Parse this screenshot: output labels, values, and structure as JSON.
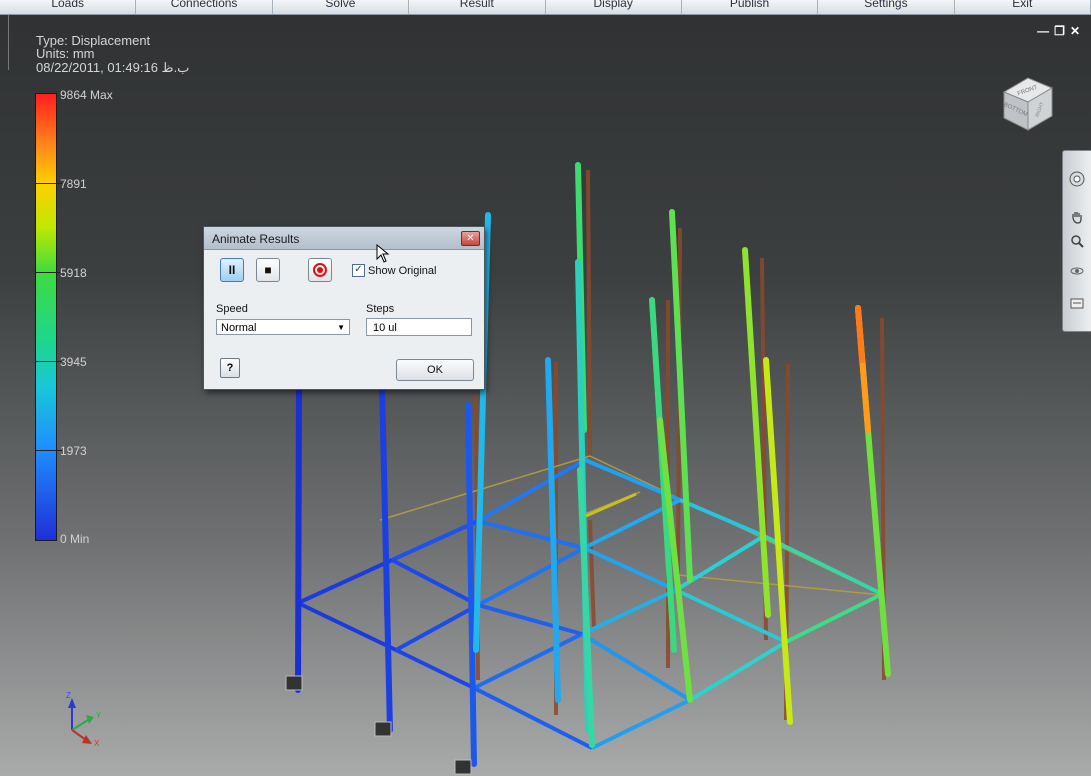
{
  "ribbon": {
    "tabs": [
      "Loads",
      "Connections",
      "Solve",
      "Result",
      "Display",
      "Publish",
      "Settings",
      "Exit"
    ]
  },
  "result_info": {
    "type": "Type: Displacement",
    "units": "Units: mm",
    "datetime": "08/22/2011, 01:49:16 ب.ظ"
  },
  "legend": {
    "max_label": "9864 Max",
    "values": [
      "7891",
      "5918",
      "3945",
      "1973"
    ],
    "min_label": "0 Min"
  },
  "window_controls": {
    "minimize": "—",
    "restore": "❐",
    "close": "✕"
  },
  "viewcube": {
    "faces": [
      "FRONT",
      "BOTTOM",
      "RIGHT"
    ]
  },
  "triad": {
    "z": "Z",
    "y": "Y",
    "x": "X"
  },
  "dialog": {
    "title": "Animate Results",
    "show_original_label": "Show Original",
    "show_original_checked": true,
    "speed_label": "Speed",
    "speed_value": "Normal",
    "steps_label": "Steps",
    "steps_value": "10 ul",
    "ok_label": "OK",
    "help_glyph": "?",
    "pause_glyph": "II",
    "stop_glyph": "■"
  },
  "colors": {
    "legend_top": "#ff1f1f",
    "legend_bottom": "#1f2fd8",
    "dialog_bg": "#eceff2",
    "original_frame": "#8b4a2b"
  }
}
